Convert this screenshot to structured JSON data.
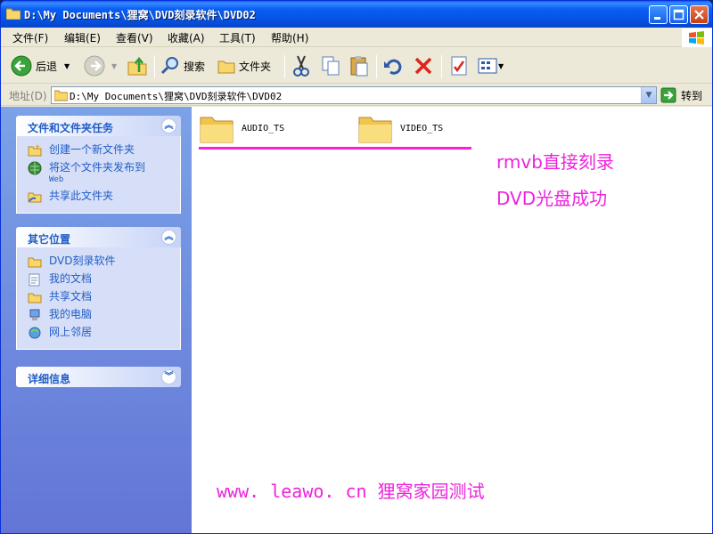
{
  "window": {
    "title": "D:\\My Documents\\狸窝\\DVD刻录软件\\DVD02"
  },
  "menu": {
    "items": [
      "文件(F)",
      "编辑(E)",
      "查看(V)",
      "收藏(A)",
      "工具(T)",
      "帮助(H)"
    ]
  },
  "toolbar": {
    "back_label": "后退",
    "search_label": "搜索",
    "folders_label": "文件夹"
  },
  "address": {
    "label": "地址(D)",
    "value": "D:\\My Documents\\狸窝\\DVD刻录软件\\DVD02",
    "go_label": "转到"
  },
  "taskpane": {
    "file_tasks": {
      "title": "文件和文件夹任务",
      "links": [
        {
          "label": "创建一个新文件夹",
          "icon": "new-folder-icon"
        },
        {
          "label": "将这个文件夹发布到",
          "sub": "Web",
          "icon": "publish-web-icon"
        },
        {
          "label": "共享此文件夹",
          "icon": "share-folder-icon"
        }
      ]
    },
    "other_places": {
      "title": "其它位置",
      "links": [
        {
          "label": "DVD刻录软件",
          "icon": "folder-icon"
        },
        {
          "label": "我的文档",
          "icon": "my-documents-icon"
        },
        {
          "label": "共享文档",
          "icon": "shared-documents-icon"
        },
        {
          "label": "我的电脑",
          "icon": "my-computer-icon"
        },
        {
          "label": "网上邻居",
          "icon": "network-places-icon"
        }
      ]
    },
    "details": {
      "title": "详细信息"
    }
  },
  "content": {
    "folders": [
      {
        "name": "AUDIO_TS"
      },
      {
        "name": "VIDEO_TS"
      }
    ],
    "annotations": {
      "line1": "rmvb直接刻录",
      "line2": "DVD光盘成功",
      "footer": "www. leawo. cn  狸窝家园测试"
    }
  },
  "colors": {
    "title_blue": "#0553e3",
    "annotation_magenta": "#ee22dd",
    "task_link": "#215dc6"
  }
}
